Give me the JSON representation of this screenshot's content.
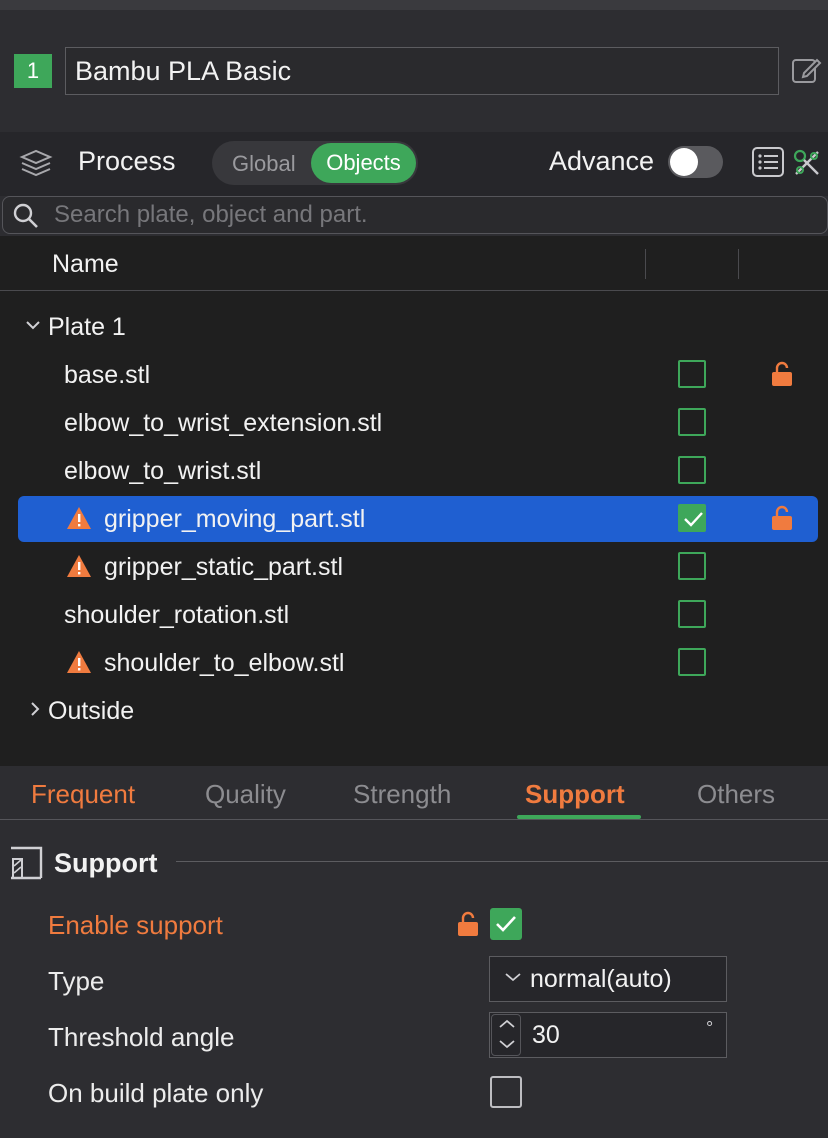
{
  "filament": {
    "index": "1",
    "name": "Bambu PLA Basic"
  },
  "process": {
    "title": "Process",
    "scope_options": [
      "Global",
      "Objects"
    ],
    "scope_selected": "Objects",
    "advance_label": "Advance",
    "advance_on": false
  },
  "search": {
    "placeholder": "Search plate, object and part."
  },
  "object_list": {
    "header_name": "Name",
    "plate": {
      "label": "Plate 1",
      "expanded": true,
      "items": [
        {
          "label": "base.stl",
          "warning": false,
          "checked": false,
          "lock": true,
          "selected": false
        },
        {
          "label": "elbow_to_wrist_extension.stl",
          "warning": false,
          "checked": false,
          "lock": false,
          "selected": false
        },
        {
          "label": "elbow_to_wrist.stl",
          "warning": false,
          "checked": false,
          "lock": false,
          "selected": false
        },
        {
          "label": "gripper_moving_part.stl",
          "warning": true,
          "checked": true,
          "lock": true,
          "selected": true
        },
        {
          "label": "gripper_static_part.stl",
          "warning": true,
          "checked": false,
          "lock": false,
          "selected": false
        },
        {
          "label": "shoulder_rotation.stl",
          "warning": false,
          "checked": false,
          "lock": false,
          "selected": false
        },
        {
          "label": "shoulder_to_elbow.stl",
          "warning": true,
          "checked": false,
          "lock": false,
          "selected": false
        }
      ]
    },
    "outside": {
      "label": "Outside",
      "expanded": false
    }
  },
  "tabs": {
    "items": [
      "Frequent",
      "Quality",
      "Strength",
      "Support",
      "Others"
    ],
    "active": "Support"
  },
  "support": {
    "section_title": "Support",
    "enable_label": "Enable support",
    "enable_checked": true,
    "type_label": "Type",
    "type_value": "normal(auto)",
    "threshold_label": "Threshold angle",
    "threshold_value": "30",
    "threshold_unit": "°",
    "build_plate_label": "On build plate only",
    "build_plate_checked": false
  },
  "colors": {
    "accent_green": "#3ea75a",
    "selection_blue": "#1f5fd1",
    "warning_orange": "#f07b3f"
  }
}
